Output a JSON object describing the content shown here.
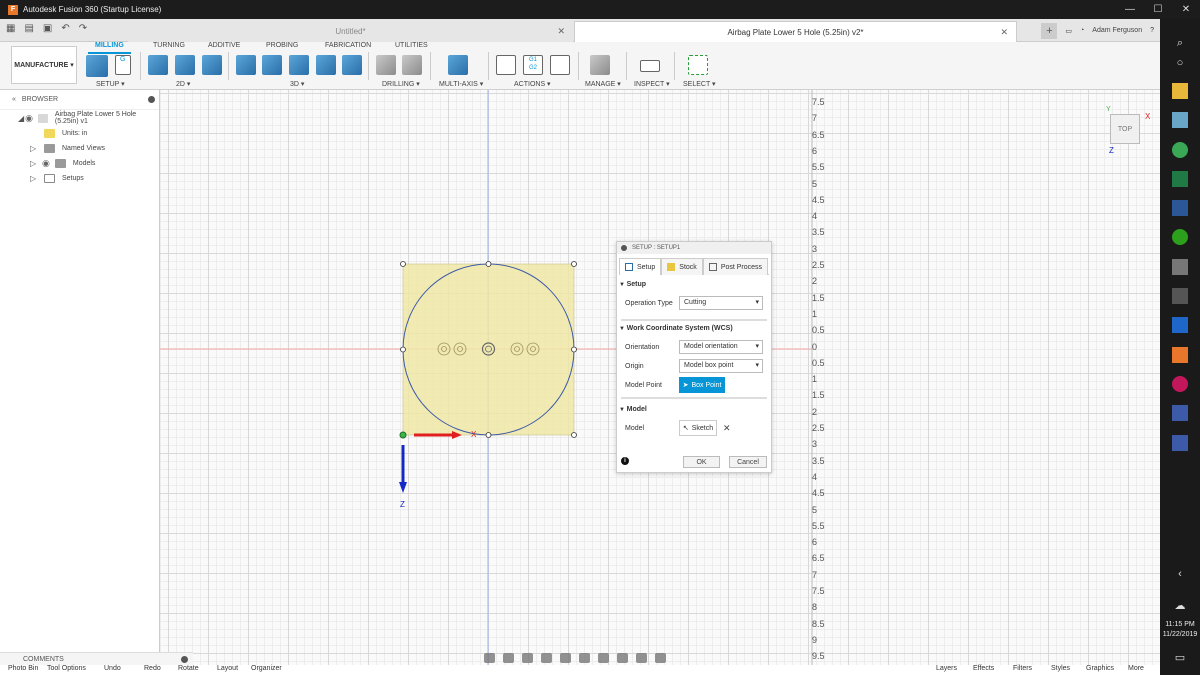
{
  "window": {
    "app_icon": "F",
    "title": "Autodesk Fusion 360 (Startup License)",
    "min": "—",
    "max": "☐",
    "close": "✕"
  },
  "tabs": {
    "inactive_label": "Untitled*",
    "active_label": "Airbag Plate Lower 5 Hole (5.25in) v2*",
    "user_name": "Adam Ferguson",
    "help": "?"
  },
  "toolbar": {
    "workspace": "MANUFACTURE ▾",
    "ribbon_tabs": [
      "MILLING",
      "TURNING",
      "ADDITIVE",
      "PROBING",
      "FABRICATION",
      "UTILITIES"
    ],
    "groups": [
      "SETUP ▾",
      "2D ▾",
      "3D ▾",
      "DRILLING ▾",
      "MULTI-AXIS ▾",
      "ACTIONS ▾",
      "MANAGE ▾",
      "INSPECT ▾",
      "SELECT ▾"
    ],
    "g_code_icon_text": "G1\nG2",
    "g_icon_text": "G"
  },
  "browser": {
    "title": "BROWSER",
    "root_label": "Airbag Plate Lower 5 Hole (5.25in) v1",
    "units": "Units: in",
    "named_views": "Named Views",
    "models": "Models",
    "setups": "Setups"
  },
  "comments": "COMMENTS",
  "viewcube": {
    "face": "TOP",
    "axis_x": "X",
    "axis_y": "Y",
    "axis_z": "Z"
  },
  "canvas": {
    "axis_x_label": "X",
    "axis_z_label": "Z"
  },
  "ruler": [
    "7.5",
    "7",
    "6.5",
    "6",
    "5.5",
    "5",
    "4.5",
    "4",
    "3.5",
    "3",
    "2.5",
    "2",
    "1.5",
    "1",
    "0.5",
    "0",
    "0.5",
    "1",
    "1.5",
    "2",
    "2.5",
    "3",
    "3.5",
    "4",
    "4.5",
    "5",
    "5.5",
    "6",
    "6.5",
    "7",
    "7.5",
    "8",
    "8.5",
    "9",
    "9.5"
  ],
  "dialog": {
    "title": "SETUP : SETUP1",
    "tabs": [
      "Setup",
      "Stock",
      "Post Process"
    ],
    "section_setup": "Setup",
    "operation_type_label": "Operation Type",
    "operation_type_value": "Cutting",
    "section_wcs": "Work Coordinate System (WCS)",
    "orientation_label": "Orientation",
    "orientation_value": "Model orientation",
    "origin_label": "Origin",
    "origin_value": "Model box point",
    "model_point_label": "Model Point",
    "model_point_value": "Box Point",
    "section_model": "Model",
    "model_label": "Model",
    "model_value": "Sketch",
    "model_clear": "✕",
    "info": "i",
    "ok": "OK",
    "cancel": "Cancel"
  },
  "bottom": [
    "Photo Bin",
    "Tool Options",
    "Undo",
    "Redo",
    "Rotate",
    "Layout",
    "Organizer",
    "Layers",
    "Effects",
    "Filters",
    "Styles",
    "Graphics",
    "More"
  ],
  "taskbar": {
    "time": "11:15 PM",
    "date": "11/22/2019"
  },
  "colors": {
    "accent": "#0696d7",
    "stock": "#efe7a6",
    "axis_x": "#e02020",
    "axis_z": "#1428c8"
  }
}
